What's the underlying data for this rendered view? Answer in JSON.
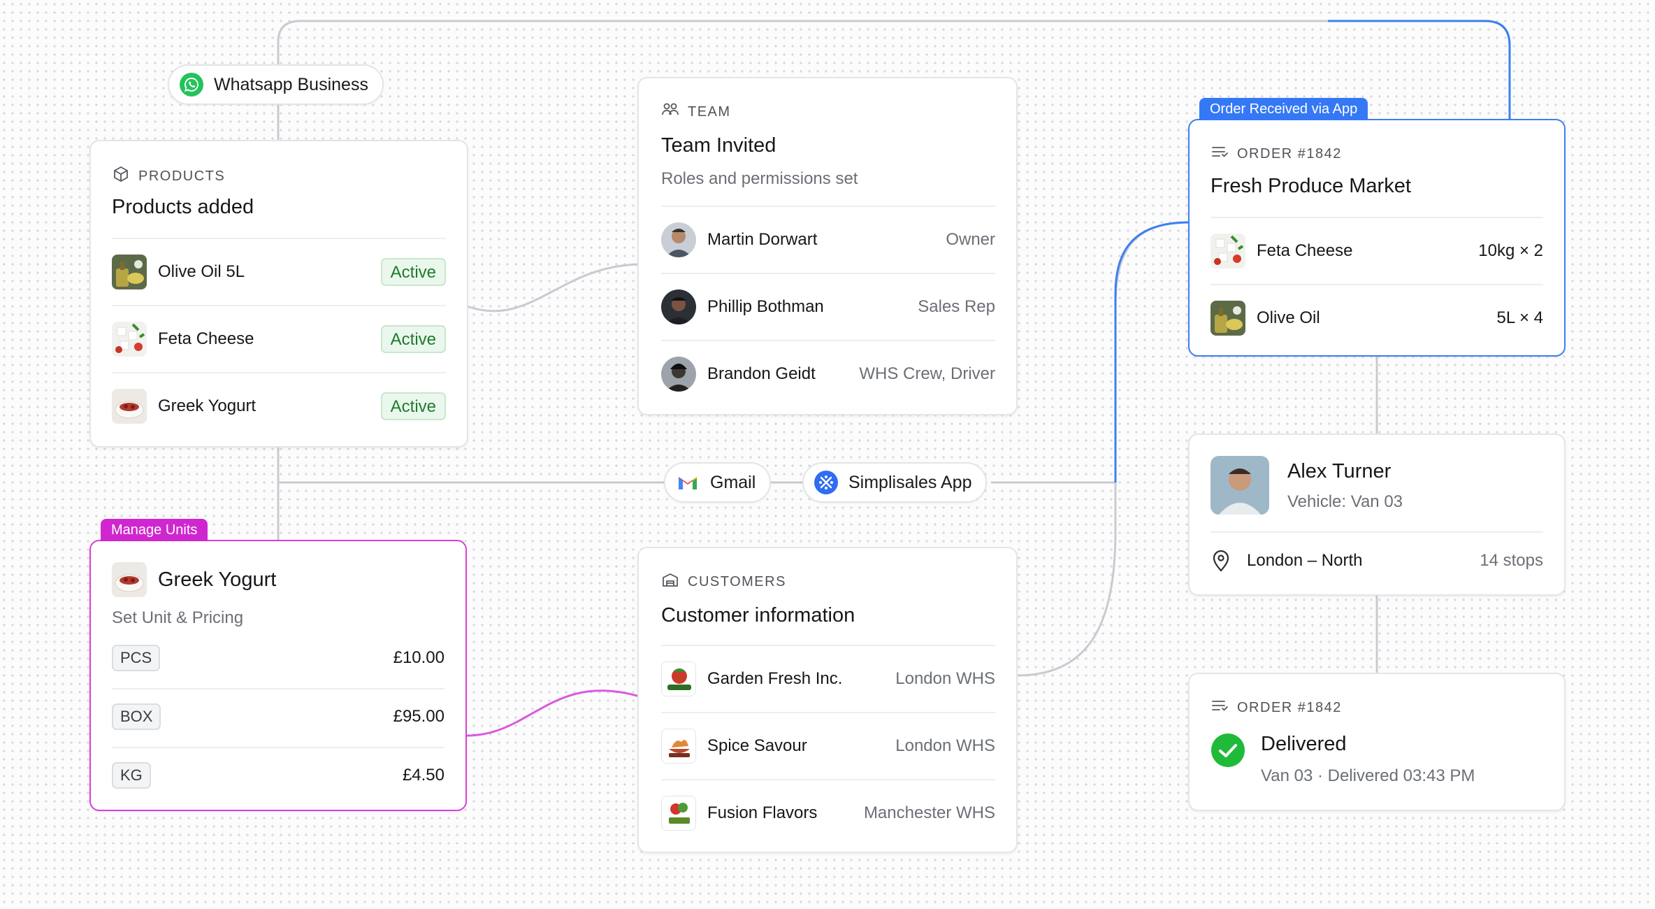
{
  "pills": {
    "whatsapp": "Whatsapp Business",
    "gmail": "Gmail",
    "simplisales": "Simplisales App"
  },
  "products": {
    "eyebrow": "PRODUCTS",
    "title": "Products added",
    "items": [
      {
        "name": "Olive Oil 5L",
        "status": "Active"
      },
      {
        "name": "Feta Cheese",
        "status": "Active"
      },
      {
        "name": "Greek Yogurt",
        "status": "Active"
      }
    ]
  },
  "manage": {
    "tag": "Manage Units",
    "title": "Greek Yogurt",
    "subtitle": "Set Unit & Pricing",
    "units": [
      {
        "unit": "PCS",
        "price": "£10.00"
      },
      {
        "unit": "BOX",
        "price": "£95.00"
      },
      {
        "unit": "KG",
        "price": "£4.50"
      }
    ]
  },
  "team": {
    "eyebrow": "TEAM",
    "title": "Team Invited",
    "subtitle": "Roles and permissions set",
    "members": [
      {
        "name": "Martin Dorwart",
        "role": "Owner"
      },
      {
        "name": "Phillip Bothman",
        "role": "Sales Rep"
      },
      {
        "name": "Brandon Geidt",
        "role": "WHS Crew, Driver"
      }
    ]
  },
  "customers": {
    "eyebrow": "CUSTOMERS",
    "title": "Customer information",
    "items": [
      {
        "name": "Garden Fresh Inc.",
        "location": "London WHS"
      },
      {
        "name": "Spice Savour",
        "location": "London WHS"
      },
      {
        "name": "Fusion Flavors",
        "location": "Manchester WHS"
      }
    ]
  },
  "order": {
    "tag": "Order Received via App",
    "eyebrow": "ORDER #1842",
    "title": "Fresh Produce Market",
    "items": [
      {
        "name": "Feta Cheese",
        "qty": "10kg × 2"
      },
      {
        "name": "Olive Oil",
        "qty": "5L × 4"
      }
    ]
  },
  "driver": {
    "name": "Alex Turner",
    "vehicle": "Vehicle: Van 03",
    "route": "London – North",
    "stops": "14 stops"
  },
  "delivered": {
    "eyebrow": "ORDER #1842",
    "title": "Delivered",
    "detail": "Van 03 · Delivered 03:43 PM"
  },
  "colors": {
    "accent_blue": "#3478f6",
    "accent_magenta": "#d026cf",
    "active_green": "#1f7a2d",
    "success_green": "#1fba3a"
  },
  "icons": [
    "whatsapp-icon",
    "gmail-icon",
    "simplisales-icon",
    "box-icon",
    "team-icon",
    "building-icon",
    "order-list-icon",
    "location-pin-icon",
    "check-circle-icon"
  ]
}
